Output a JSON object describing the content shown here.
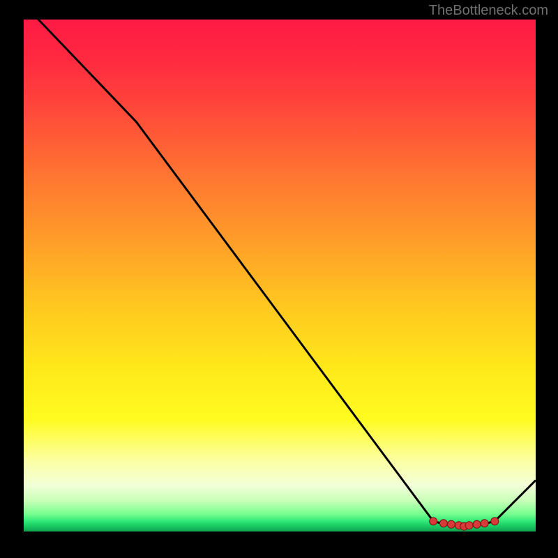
{
  "watermark": "TheBottleneck.com",
  "chart_data": {
    "type": "line",
    "title": "",
    "xlabel": "",
    "ylabel": "",
    "xlim": [
      0,
      100
    ],
    "ylim": [
      0,
      100
    ],
    "x": [
      0,
      22,
      80,
      82,
      84,
      86,
      88,
      90,
      92,
      100
    ],
    "values": [
      103,
      80,
      2,
      1.5,
      1.2,
      1.0,
      1.2,
      1.5,
      2.0,
      10
    ],
    "markers": {
      "x": [
        80,
        82,
        83.5,
        85,
        86,
        87,
        88.5,
        90,
        92
      ],
      "values": [
        2.0,
        1.6,
        1.4,
        1.2,
        1.0,
        1.2,
        1.4,
        1.6,
        2.0
      ]
    },
    "grid": false,
    "legend_position": "none",
    "colors": {
      "line": "#000000",
      "marker_fill": "#d83a3a",
      "marker_stroke": "#7a1010"
    }
  }
}
